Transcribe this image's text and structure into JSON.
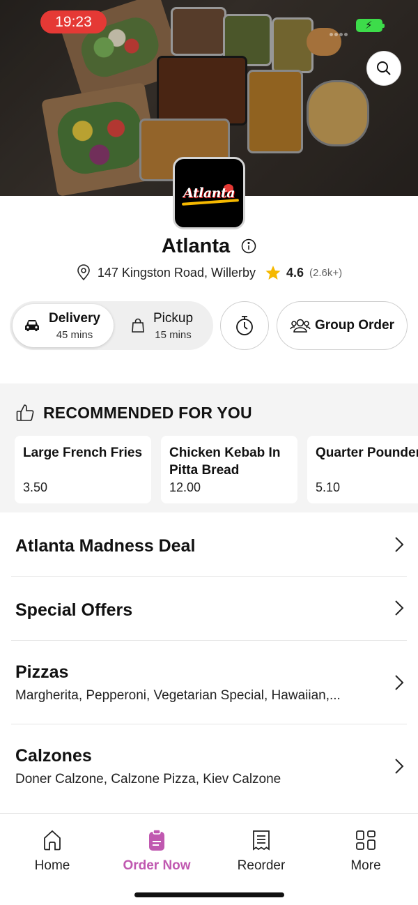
{
  "status_bar": {
    "time": "19:23"
  },
  "restaurant": {
    "name": "Atlanta",
    "logo_text": "Atlanta",
    "address": "147 Kingston Road, Willerby",
    "rating": "4.6",
    "rating_count": "(2.6k+)"
  },
  "modes": {
    "delivery": {
      "label": "Delivery",
      "time": "45 mins"
    },
    "pickup": {
      "label": "Pickup",
      "time": "15 mins"
    },
    "group_order_label": "Group Order"
  },
  "recommended": {
    "heading": "RECOMMENDED FOR YOU",
    "items": [
      {
        "name": "Large French Fries",
        "price": "3.50"
      },
      {
        "name": "Chicken Kebab In Pitta Bread",
        "price": "12.00"
      },
      {
        "name": "Quarter Pounder Cheese Burger",
        "price": "5.10"
      }
    ]
  },
  "categories": [
    {
      "title": "Atlanta Madness Deal",
      "description": ""
    },
    {
      "title": "Special Offers",
      "description": ""
    },
    {
      "title": "Pizzas",
      "description": "Margherita, Pepperoni, Vegetarian Special, Hawaiian,..."
    },
    {
      "title": "Calzones",
      "description": "Doner Calzone, Calzone Pizza, Kiev Calzone"
    }
  ],
  "bottom_nav": {
    "items": [
      {
        "label": "Home",
        "icon": "home-icon"
      },
      {
        "label": "Order Now",
        "icon": "order-icon"
      },
      {
        "label": "Reorder",
        "icon": "receipt-icon"
      },
      {
        "label": "More",
        "icon": "grid-icon"
      }
    ],
    "active": "Order Now"
  },
  "colors": {
    "accent": "#c058b0",
    "status_time_bg": "#e53935",
    "star": "#f5b800",
    "battery": "#3ddc4a"
  }
}
